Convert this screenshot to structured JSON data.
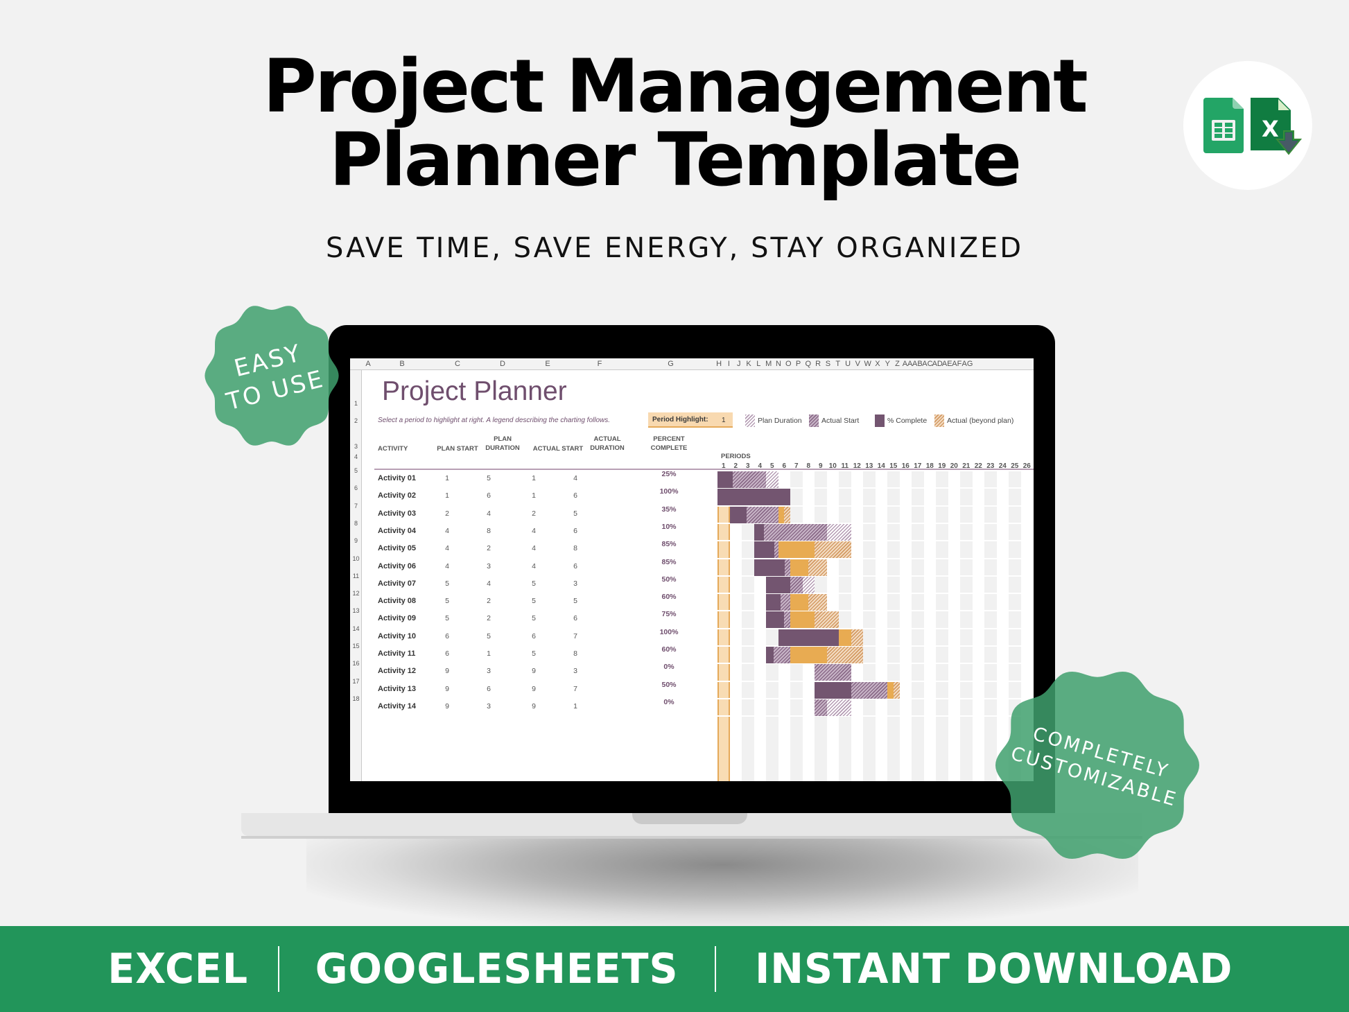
{
  "header": {
    "title_line1": "Project Management",
    "title_line2": "Planner Template",
    "subtitle": "SAVE TIME, SAVE ENERGY, STAY ORGANIZED"
  },
  "logos": [
    "google-sheets-icon",
    "excel-download-icon"
  ],
  "badges": {
    "easy": [
      "EASY",
      "TO USE"
    ],
    "custom": [
      "COMPLETELY",
      "CUSTOMIZABLE"
    ]
  },
  "banner": {
    "items": [
      "EXCEL",
      "GOOGLESHEETS",
      "INSTANT DOWNLOAD"
    ]
  },
  "colors": {
    "brand_green": "#22955a",
    "badge_green": "#55ab7f",
    "purple": "#735570",
    "orange": "#e8ab52",
    "highlight": "#f8dcb4"
  },
  "spreadsheet": {
    "column_headers": [
      "A",
      "B",
      "C",
      "D",
      "E",
      "F",
      "G",
      "H",
      "I",
      "J",
      "K",
      "L",
      "M",
      "N",
      "O",
      "P",
      "Q",
      "R",
      "S",
      "T",
      "U",
      "V",
      "W",
      "X",
      "Y",
      "Z",
      "AA",
      "AB",
      "AC",
      "AD",
      "AE",
      "AF",
      "AG"
    ],
    "row_headers": [
      "1",
      "2",
      "3",
      "4",
      "5",
      "6",
      "7",
      "8",
      "9",
      "10",
      "11",
      "12",
      "13",
      "14",
      "15",
      "16",
      "17",
      "18"
    ],
    "title": "Project Planner",
    "instructions": "Select a period to highlight at right.  A legend describing the charting follows.",
    "period_highlight_label": "Period Highlight:",
    "period_highlight_value": "1",
    "legend": [
      {
        "label": "Plan Duration",
        "style": "hatch-plan"
      },
      {
        "label": "Actual Start",
        "style": "hatch-actual"
      },
      {
        "label": "% Complete",
        "style": "solid-complete"
      },
      {
        "label": "Actual (beyond plan)",
        "style": "hatch-beyond"
      }
    ],
    "table_headers": {
      "activity": "ACTIVITY",
      "plan_start": "PLAN START",
      "plan_duration": "PLAN DURATION",
      "actual_start": "ACTUAL START",
      "actual_duration": "ACTUAL DURATION",
      "percent_complete": "PERCENT COMPLETE",
      "periods": "PERIODS"
    },
    "periods": [
      "1",
      "2",
      "3",
      "4",
      "5",
      "6",
      "7",
      "8",
      "9",
      "10",
      "11",
      "12",
      "13",
      "14",
      "15",
      "16",
      "17",
      "18",
      "19",
      "20",
      "21",
      "22",
      "23",
      "24",
      "25",
      "26"
    ],
    "activities": [
      {
        "name": "Activity 01",
        "plan_start": "1",
        "plan_duration": "5",
        "actual_start": "1",
        "actual_duration": "4",
        "percent": "25%"
      },
      {
        "name": "Activity 02",
        "plan_start": "1",
        "plan_duration": "6",
        "actual_start": "1",
        "actual_duration": "6",
        "percent": "100%"
      },
      {
        "name": "Activity 03",
        "plan_start": "2",
        "plan_duration": "4",
        "actual_start": "2",
        "actual_duration": "5",
        "percent": "35%"
      },
      {
        "name": "Activity 04",
        "plan_start": "4",
        "plan_duration": "8",
        "actual_start": "4",
        "actual_duration": "6",
        "percent": "10%"
      },
      {
        "name": "Activity 05",
        "plan_start": "4",
        "plan_duration": "2",
        "actual_start": "4",
        "actual_duration": "8",
        "percent": "85%"
      },
      {
        "name": "Activity 06",
        "plan_start": "4",
        "plan_duration": "3",
        "actual_start": "4",
        "actual_duration": "6",
        "percent": "85%"
      },
      {
        "name": "Activity 07",
        "plan_start": "5",
        "plan_duration": "4",
        "actual_start": "5",
        "actual_duration": "3",
        "percent": "50%"
      },
      {
        "name": "Activity 08",
        "plan_start": "5",
        "plan_duration": "2",
        "actual_start": "5",
        "actual_duration": "5",
        "percent": "60%"
      },
      {
        "name": "Activity 09",
        "plan_start": "5",
        "plan_duration": "2",
        "actual_start": "5",
        "actual_duration": "6",
        "percent": "75%"
      },
      {
        "name": "Activity 10",
        "plan_start": "6",
        "plan_duration": "5",
        "actual_start": "6",
        "actual_duration": "7",
        "percent": "100%"
      },
      {
        "name": "Activity 11",
        "plan_start": "6",
        "plan_duration": "1",
        "actual_start": "5",
        "actual_duration": "8",
        "percent": "60%"
      },
      {
        "name": "Activity 12",
        "plan_start": "9",
        "plan_duration": "3",
        "actual_start": "9",
        "actual_duration": "3",
        "percent": "0%"
      },
      {
        "name": "Activity 13",
        "plan_start": "9",
        "plan_duration": "6",
        "actual_start": "9",
        "actual_duration": "7",
        "percent": "50%"
      },
      {
        "name": "Activity 14",
        "plan_start": "9",
        "plan_duration": "3",
        "actual_start": "9",
        "actual_duration": "1",
        "percent": "0%"
      }
    ]
  }
}
